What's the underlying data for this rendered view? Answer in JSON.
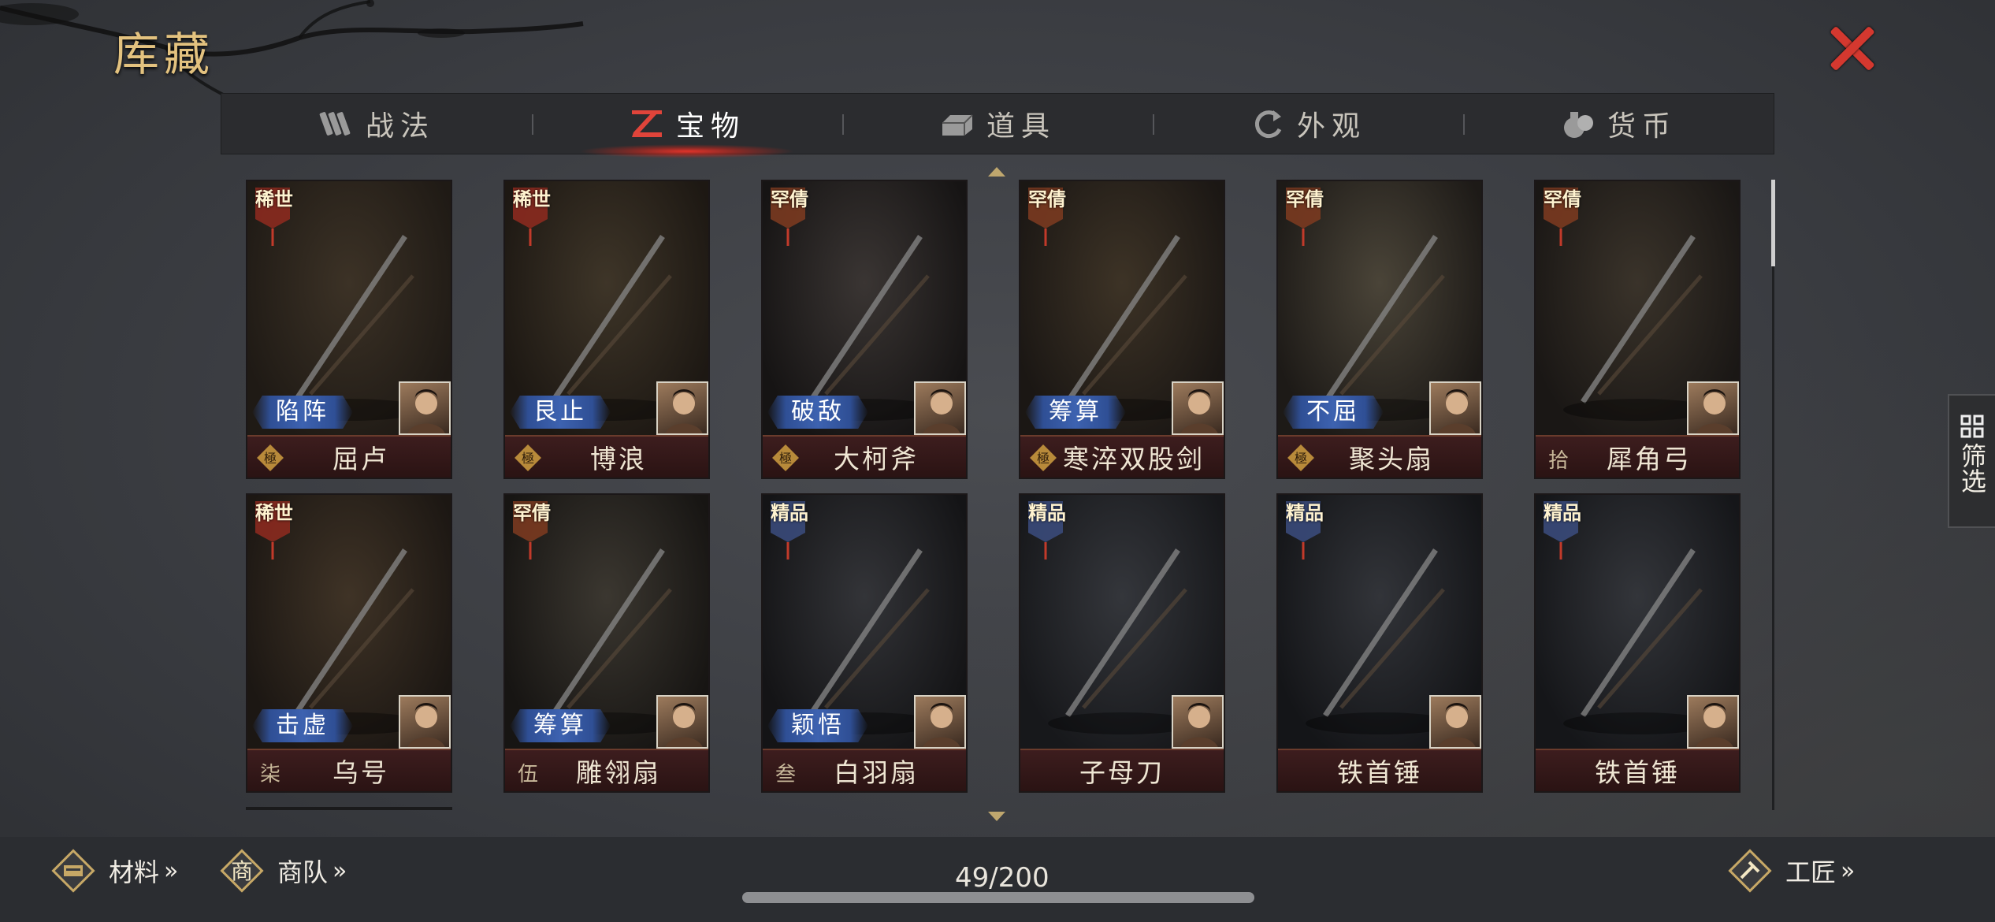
{
  "header": {
    "title": "库藏"
  },
  "tabs": [
    {
      "label": "战法",
      "icon": "scroll-icon"
    },
    {
      "label": "宝物",
      "icon": "treasure-icon",
      "active": true
    },
    {
      "label": "道具",
      "icon": "ingot-icon"
    },
    {
      "label": "外观",
      "icon": "refresh-icon"
    },
    {
      "label": "货币",
      "icon": "money-bag-icon"
    }
  ],
  "items": [
    {
      "rarity": "稀世",
      "skill": "陷阵",
      "level": "極",
      "name": "屈卢"
    },
    {
      "rarity": "稀世",
      "skill": "艮止",
      "level": "極",
      "name": "博浪"
    },
    {
      "rarity": "罕倩",
      "skill": "破敌",
      "level": "極",
      "name": "大柯斧"
    },
    {
      "rarity": "罕倩",
      "skill": "筹算",
      "level": "極",
      "name": "寒淬双股剑"
    },
    {
      "rarity": "罕倩",
      "skill": "不屈",
      "level": "極",
      "name": "聚头扇"
    },
    {
      "rarity": "罕倩",
      "skill": "",
      "level": "拾",
      "name": "犀角弓"
    },
    {
      "rarity": "稀世",
      "skill": "击虚",
      "level": "柒",
      "name": "乌号"
    },
    {
      "rarity": "罕倩",
      "skill": "筹算",
      "level": "伍",
      "name": "雕翎扇"
    },
    {
      "rarity": "精品",
      "skill": "颖悟",
      "level": "叁",
      "name": "白羽扇"
    },
    {
      "rarity": "精品",
      "skill": "",
      "level": "",
      "name": "子母刀"
    },
    {
      "rarity": "精品",
      "skill": "",
      "level": "",
      "name": "铁首锤"
    },
    {
      "rarity": "精品",
      "skill": "",
      "level": "",
      "name": "铁首锤"
    }
  ],
  "footer": {
    "materials": "材料",
    "caravan": "商队",
    "caravan_glyph": "商",
    "craftsman": "工匠",
    "counter": "49/200"
  },
  "filter": {
    "label": "筛选"
  },
  "colors": {
    "accent_red": "#d4382f",
    "gold": "#e3c27f",
    "skill_blue": "#3d62b0",
    "namebar": "#3d1d1e"
  }
}
